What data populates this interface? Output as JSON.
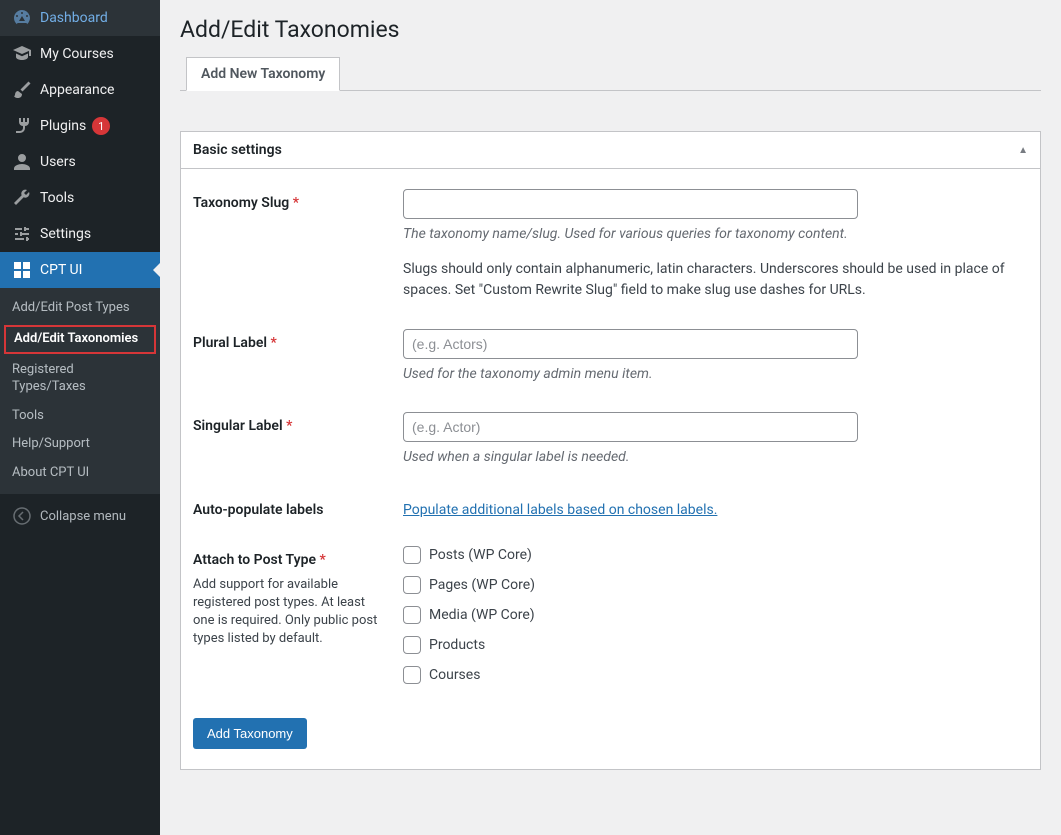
{
  "sidebar": {
    "items": [
      {
        "id": "dashboard",
        "label": "Dashboard"
      },
      {
        "id": "courses",
        "label": "My Courses"
      },
      {
        "id": "appearance",
        "label": "Appearance"
      },
      {
        "id": "plugins",
        "label": "Plugins",
        "badge": "1"
      },
      {
        "id": "users",
        "label": "Users"
      },
      {
        "id": "tools",
        "label": "Tools"
      },
      {
        "id": "settings",
        "label": "Settings"
      },
      {
        "id": "cptui",
        "label": "CPT UI"
      }
    ],
    "submenu": [
      {
        "label": "Add/Edit Post Types"
      },
      {
        "label": "Add/Edit Taxonomies",
        "active": true
      },
      {
        "label": "Registered Types/Taxes"
      },
      {
        "label": "Tools"
      },
      {
        "label": "Help/Support"
      },
      {
        "label": "About CPT UI"
      }
    ],
    "collapse": "Collapse menu"
  },
  "page": {
    "title": "Add/Edit Taxonomies",
    "tab": "Add New Taxonomy",
    "panel_head": "Basic settings",
    "submit": "Add Taxonomy"
  },
  "fields": {
    "slug": {
      "label": "Taxonomy Slug",
      "help1": "The taxonomy name/slug. Used for various queries for taxonomy content.",
      "help2": "Slugs should only contain alphanumeric, latin characters. Underscores should be used in place of spaces. Set \"Custom Rewrite Slug\" field to make slug use dashes for URLs."
    },
    "plural": {
      "label": "Plural Label",
      "placeholder": "(e.g. Actors)",
      "help": "Used for the taxonomy admin menu item."
    },
    "singular": {
      "label": "Singular Label",
      "placeholder": "(e.g. Actor)",
      "help": "Used when a singular label is needed."
    },
    "auto": {
      "label": "Auto-populate labels",
      "link": "Populate additional labels based on chosen labels."
    },
    "attach": {
      "label": "Attach to Post Type",
      "sublabel": "Add support for available registered post types. At least one is required. Only public post types listed by default.",
      "options": [
        "Posts (WP Core)",
        "Pages (WP Core)",
        "Media (WP Core)",
        "Products",
        "Courses"
      ]
    }
  }
}
